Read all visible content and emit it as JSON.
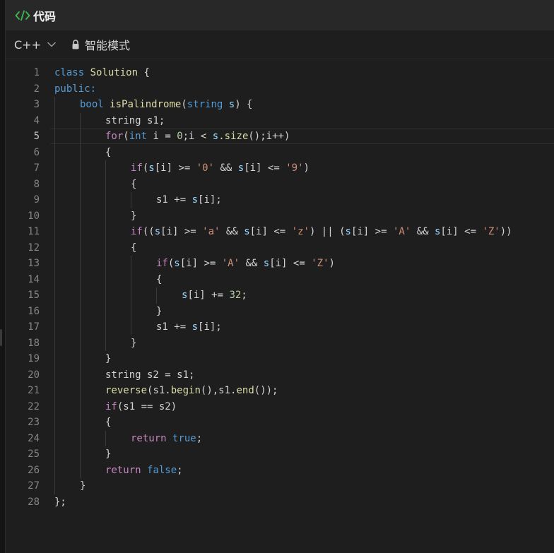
{
  "title": {
    "text": "代码",
    "icon": "code-icon",
    "icon_color": "#3fb950"
  },
  "toolbar": {
    "language": "C++",
    "mode_label": "智能模式",
    "lock_icon": "lock-icon"
  },
  "editor": {
    "active_line": 5,
    "colors": {
      "keyword": "#c586c0",
      "type": "#569cd6",
      "function": "#dcdcaa",
      "string": "#ce9178",
      "number": "#b5cea8",
      "variable": "#9cdcfe",
      "text": "#d4d4d4",
      "line_number": "#858585"
    },
    "lines": [
      {
        "n": "1",
        "indent": 0,
        "tokens": [
          [
            "kb",
            "class"
          ],
          [
            "t",
            " "
          ],
          [
            "cls",
            "Solution"
          ],
          [
            "t",
            " {"
          ]
        ]
      },
      {
        "n": "2",
        "indent": 0,
        "tokens": [
          [
            "pub",
            "public:"
          ]
        ]
      },
      {
        "n": "3",
        "indent": 1,
        "tokens": [
          [
            "kb",
            "bool"
          ],
          [
            "t",
            " "
          ],
          [
            "fn",
            "isPalindrome"
          ],
          [
            "t",
            "("
          ],
          [
            "kb",
            "string"
          ],
          [
            "t",
            " "
          ],
          [
            "var",
            "s"
          ],
          [
            "t",
            ") {"
          ]
        ]
      },
      {
        "n": "4",
        "indent": 2,
        "tokens": [
          [
            "t",
            "string s1;"
          ]
        ]
      },
      {
        "n": "5",
        "indent": 2,
        "tokens": [
          [
            "kw",
            "for"
          ],
          [
            "t",
            "("
          ],
          [
            "kb",
            "int"
          ],
          [
            "t",
            " i = "
          ],
          [
            "num",
            "0"
          ],
          [
            "t",
            ";i < "
          ],
          [
            "var",
            "s"
          ],
          [
            "t",
            "."
          ],
          [
            "fn",
            "size"
          ],
          [
            "t",
            "();i++)"
          ]
        ]
      },
      {
        "n": "6",
        "indent": 2,
        "tokens": [
          [
            "t",
            "{"
          ]
        ]
      },
      {
        "n": "7",
        "indent": 3,
        "tokens": [
          [
            "kw",
            "if"
          ],
          [
            "t",
            "("
          ],
          [
            "var",
            "s"
          ],
          [
            "t",
            "[i] >= "
          ],
          [
            "str",
            "'0'"
          ],
          [
            "t",
            " && "
          ],
          [
            "var",
            "s"
          ],
          [
            "t",
            "[i] <= "
          ],
          [
            "str",
            "'9'"
          ],
          [
            "t",
            ")"
          ]
        ]
      },
      {
        "n": "8",
        "indent": 3,
        "tokens": [
          [
            "t",
            "{"
          ]
        ]
      },
      {
        "n": "9",
        "indent": 4,
        "tokens": [
          [
            "t",
            "s1 += "
          ],
          [
            "var",
            "s"
          ],
          [
            "t",
            "[i];"
          ]
        ]
      },
      {
        "n": "10",
        "indent": 3,
        "tokens": [
          [
            "t",
            "}"
          ]
        ]
      },
      {
        "n": "11",
        "indent": 3,
        "tokens": [
          [
            "kw",
            "if"
          ],
          [
            "t",
            "(("
          ],
          [
            "var",
            "s"
          ],
          [
            "t",
            "[i] >= "
          ],
          [
            "str",
            "'a'"
          ],
          [
            "t",
            " && "
          ],
          [
            "var",
            "s"
          ],
          [
            "t",
            "[i] <= "
          ],
          [
            "str",
            "'z'"
          ],
          [
            "t",
            ") || ("
          ],
          [
            "var",
            "s"
          ],
          [
            "t",
            "[i] >= "
          ],
          [
            "str",
            "'A'"
          ],
          [
            "t",
            " && "
          ],
          [
            "var",
            "s"
          ],
          [
            "t",
            "[i] <= "
          ],
          [
            "str",
            "'Z'"
          ],
          [
            "t",
            "))"
          ]
        ]
      },
      {
        "n": "12",
        "indent": 3,
        "tokens": [
          [
            "t",
            "{"
          ]
        ]
      },
      {
        "n": "13",
        "indent": 4,
        "tokens": [
          [
            "kw",
            "if"
          ],
          [
            "t",
            "("
          ],
          [
            "var",
            "s"
          ],
          [
            "t",
            "[i] >= "
          ],
          [
            "str",
            "'A'"
          ],
          [
            "t",
            " && "
          ],
          [
            "var",
            "s"
          ],
          [
            "t",
            "[i] <= "
          ],
          [
            "str",
            "'Z'"
          ],
          [
            "t",
            ")"
          ]
        ]
      },
      {
        "n": "14",
        "indent": 4,
        "tokens": [
          [
            "t",
            "{"
          ]
        ]
      },
      {
        "n": "15",
        "indent": 5,
        "tokens": [
          [
            "var",
            "s"
          ],
          [
            "t",
            "[i] += "
          ],
          [
            "num",
            "32"
          ],
          [
            "t",
            ";"
          ]
        ]
      },
      {
        "n": "16",
        "indent": 4,
        "tokens": [
          [
            "t",
            "}"
          ]
        ]
      },
      {
        "n": "17",
        "indent": 4,
        "tokens": [
          [
            "t",
            "s1 += "
          ],
          [
            "var",
            "s"
          ],
          [
            "t",
            "[i];"
          ]
        ]
      },
      {
        "n": "18",
        "indent": 3,
        "tokens": [
          [
            "t",
            "}"
          ]
        ]
      },
      {
        "n": "19",
        "indent": 2,
        "tokens": [
          [
            "t",
            "}"
          ]
        ]
      },
      {
        "n": "20",
        "indent": 2,
        "tokens": [
          [
            "t",
            "string s2 = s1;"
          ]
        ]
      },
      {
        "n": "21",
        "indent": 2,
        "tokens": [
          [
            "fn",
            "reverse"
          ],
          [
            "t",
            "(s1."
          ],
          [
            "fn",
            "begin"
          ],
          [
            "t",
            "(),s1."
          ],
          [
            "fn",
            "end"
          ],
          [
            "t",
            "());"
          ]
        ]
      },
      {
        "n": "22",
        "indent": 2,
        "tokens": [
          [
            "kw",
            "if"
          ],
          [
            "t",
            "(s1 == s2)"
          ]
        ]
      },
      {
        "n": "23",
        "indent": 2,
        "tokens": [
          [
            "t",
            "{"
          ]
        ]
      },
      {
        "n": "24",
        "indent": 3,
        "tokens": [
          [
            "kw",
            "return"
          ],
          [
            "t",
            " "
          ],
          [
            "kb",
            "true"
          ],
          [
            "t",
            ";"
          ]
        ]
      },
      {
        "n": "25",
        "indent": 2,
        "tokens": [
          [
            "t",
            "}"
          ]
        ]
      },
      {
        "n": "26",
        "indent": 2,
        "tokens": [
          [
            "kw",
            "return"
          ],
          [
            "t",
            " "
          ],
          [
            "kb",
            "false"
          ],
          [
            "t",
            ";"
          ]
        ]
      },
      {
        "n": "27",
        "indent": 1,
        "tokens": [
          [
            "t",
            "}"
          ]
        ]
      },
      {
        "n": "28",
        "indent": 0,
        "tokens": [
          [
            "t",
            "};"
          ]
        ]
      }
    ]
  }
}
